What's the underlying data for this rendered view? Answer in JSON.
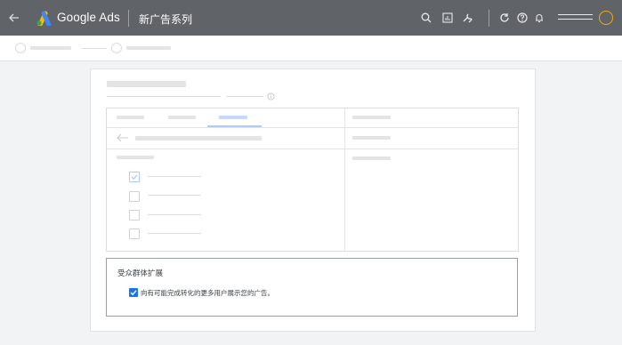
{
  "header": {
    "brand": "Google Ads",
    "title": "新广告系列",
    "icons": [
      "back-arrow-icon",
      "google-ads-logo",
      "search-icon",
      "reports-icon",
      "tools-icon",
      "refresh-icon",
      "help-icon",
      "notifications-icon",
      "account-avatar"
    ],
    "colors": {
      "bar": "#606368",
      "avatar_ring": "#f9ab00"
    }
  },
  "audience_expansion": {
    "title": "受众群体扩展",
    "checkbox_label": "向有可能完成转化的更多用户展示您的广告。",
    "checked": true,
    "accent": "#1a73e8"
  }
}
